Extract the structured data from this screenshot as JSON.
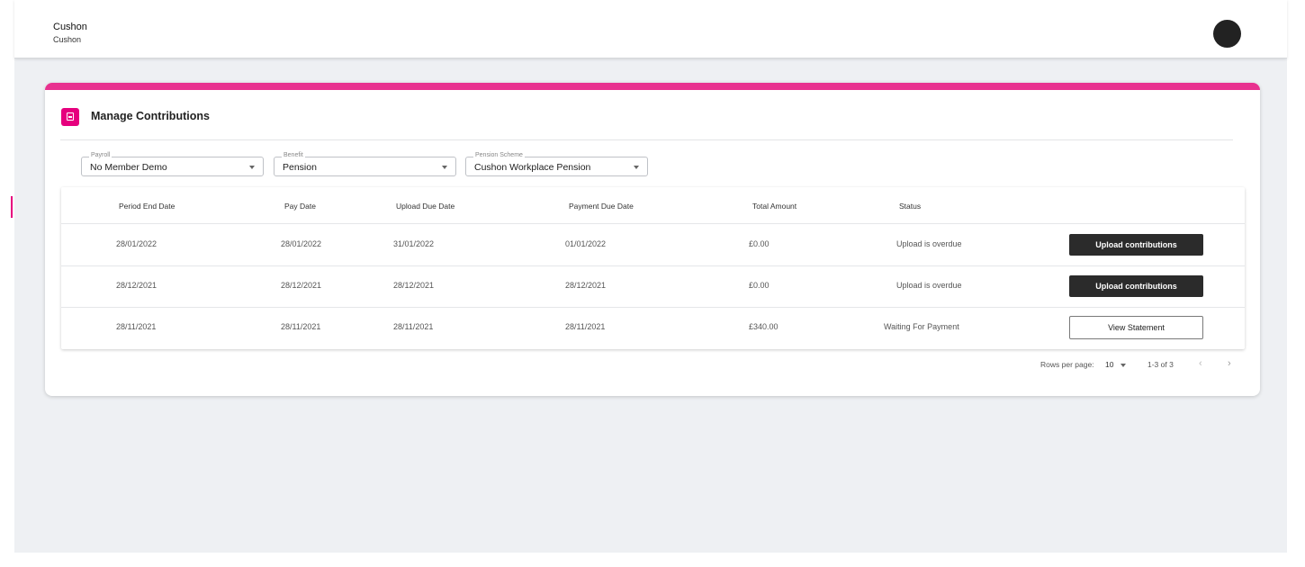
{
  "header": {
    "org_name": "Cushon",
    "org_subtitle": "Cushon",
    "avatar_icon": "user-avatar"
  },
  "card": {
    "title": "Manage Contributions",
    "icon": "contributions-icon",
    "accent_color": "#e8318f"
  },
  "filters": {
    "payroll": {
      "label": "Payroll",
      "value": "No Member Demo"
    },
    "benefit": {
      "label": "Benefit",
      "value": "Pension"
    },
    "scheme": {
      "label": "Pension Scheme",
      "value": "Cushon Workplace Pension"
    }
  },
  "table": {
    "headers": {
      "period_end": "Period End Date",
      "pay_date": "Pay Date",
      "upload_due": "Upload Due Date",
      "payment_due": "Payment Due Date",
      "total": "Total Amount",
      "status": "Status"
    },
    "rows": [
      {
        "period_end": "28/01/2022",
        "pay_date": "28/01/2022",
        "upload_due": "31/01/2022",
        "payment_due": "01/01/2022",
        "total": "£0.00",
        "status": "Upload is overdue",
        "action": "Upload contributions"
      },
      {
        "period_end": "28/12/2021",
        "pay_date": "28/12/2021",
        "upload_due": "28/12/2021",
        "payment_due": "28/12/2021",
        "total": "£0.00",
        "status": "Upload is overdue",
        "action": "Upload contributions"
      },
      {
        "period_end": "28/11/2021",
        "pay_date": "28/11/2021",
        "upload_due": "28/11/2021",
        "payment_due": "28/11/2021",
        "total": "£340.00",
        "status": "Waiting For Payment",
        "action": "View Statement"
      }
    ]
  },
  "pagination": {
    "rows_label": "Rows per page:",
    "rows_value": "10",
    "range": "1-3 of 3",
    "prev_icon": "chevron-left-icon",
    "next_icon": "chevron-right-icon"
  },
  "colors": {
    "brand_pink": "#e6007e",
    "dark_button": "#2b2b2b",
    "background": "#eef0f3"
  }
}
